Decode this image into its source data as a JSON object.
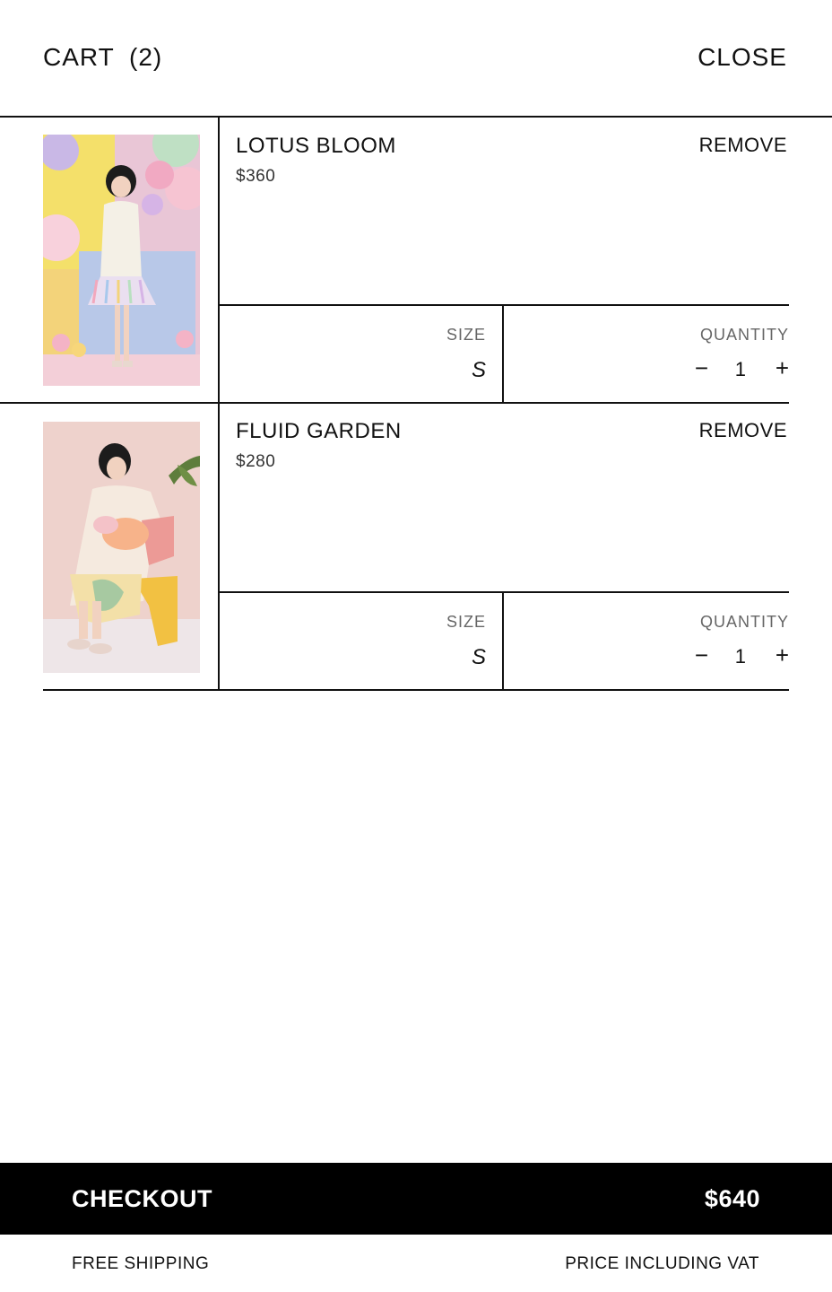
{
  "header": {
    "cart_label": "CART",
    "cart_count": "(2)",
    "close_label": "CLOSE"
  },
  "items": [
    {
      "name": "LOTUS BLOOM",
      "price": "$360",
      "remove_label": "REMOVE",
      "size_label": "SIZE",
      "size_value": "S",
      "quantity_label": "QUANTITY",
      "quantity": "1",
      "minus_icon": "−",
      "plus_icon": "+",
      "image_alt": "product-photo-lotus-bloom"
    },
    {
      "name": "FLUID GARDEN",
      "price": "$280",
      "remove_label": "REMOVE",
      "size_label": "SIZE",
      "size_value": "S",
      "quantity_label": "QUANTITY",
      "quantity": "1",
      "minus_icon": "−",
      "plus_icon": "+",
      "image_alt": "product-photo-fluid-garden"
    }
  ],
  "checkout": {
    "label": "CHECKOUT",
    "total": "$640"
  },
  "footer": {
    "shipping_note": "FREE SHIPPING",
    "vat_note": "PRICE INCLUDING VAT"
  },
  "colors": {
    "accent": "#000000",
    "text": "#111111",
    "muted": "#666666",
    "background": "#ffffff"
  }
}
